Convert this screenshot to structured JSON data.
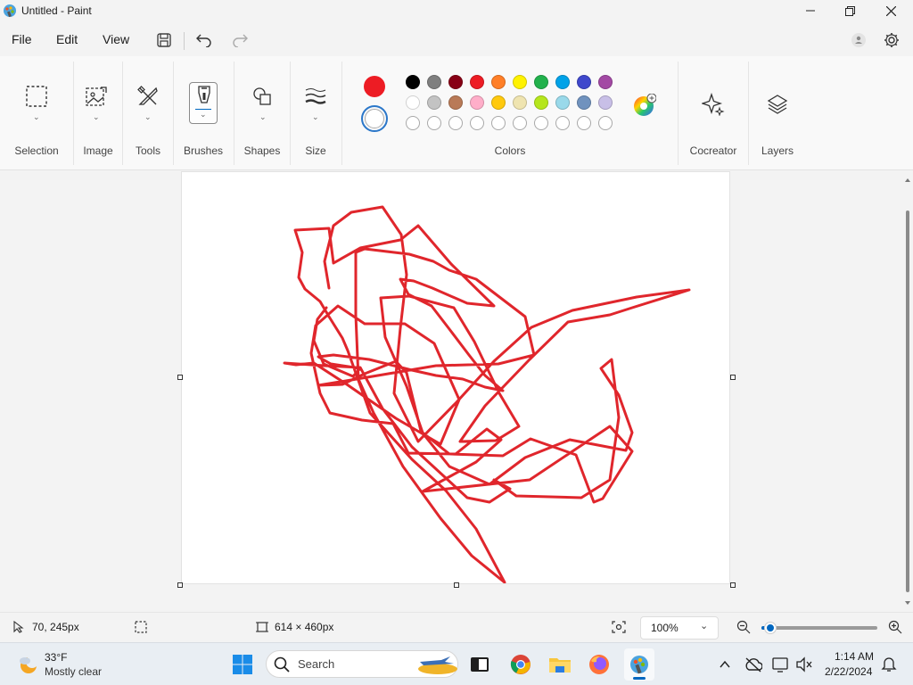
{
  "window": {
    "title": "Untitled - Paint"
  },
  "menu": {
    "file": "File",
    "edit": "Edit",
    "view": "View"
  },
  "ribbon": {
    "selection": "Selection",
    "image": "Image",
    "tools": "Tools",
    "brushes": "Brushes",
    "shapes": "Shapes",
    "size": "Size",
    "colors": "Colors",
    "cocreator": "Cocreator",
    "layers": "Layers",
    "primary_color": "#ed1c24",
    "secondary_color": "#ffffff",
    "palette_row1": [
      "#000000",
      "#7f7f7f",
      "#880015",
      "#ed1c24",
      "#ff7f27",
      "#fff200",
      "#22b14c",
      "#00a2e8",
      "#3f48cc",
      "#a349a4"
    ],
    "palette_row2": [
      "#ffffff",
      "#c3c3c3",
      "#b97a57",
      "#ffaec9",
      "#ffc90e",
      "#efe4b0",
      "#b5e61d",
      "#99d9ea",
      "#7092be",
      "#c8bfe7"
    ],
    "palette_row3": [
      "empty",
      "empty",
      "empty",
      "empty",
      "empty",
      "empty",
      "empty",
      "empty",
      "empty",
      "empty"
    ]
  },
  "canvas": {
    "stroke_color": "#e0262c"
  },
  "status": {
    "cursor_pos": "70, 245px",
    "canvas_size": "614 × 460px",
    "zoom": "100%",
    "zoom_level": 0.08
  },
  "taskbar": {
    "weather_temp": "33°F",
    "weather_desc": "Mostly clear",
    "search_placeholder": "Search",
    "time": "1:14 AM",
    "date": "2/22/2024"
  }
}
